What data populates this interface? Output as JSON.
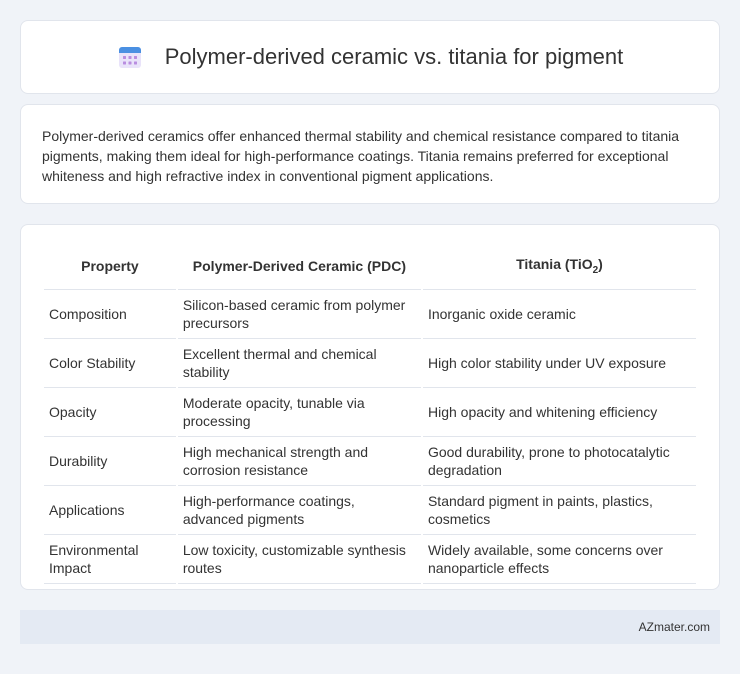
{
  "header": {
    "title": "Polymer-derived ceramic vs. titania for pigment",
    "icon": "calendar-icon"
  },
  "intro": {
    "text": "Polymer-derived ceramics offer enhanced thermal stability and chemical resistance compared to titania pigments, making them ideal for high-performance coatings. Titania remains preferred for exceptional whiteness and high refractive index in conventional pigment applications."
  },
  "table": {
    "headers": {
      "property": "Property",
      "pdc": "Polymer-Derived Ceramic (PDC)",
      "titania_prefix": "Titania (TiO",
      "titania_sub": "2",
      "titania_suffix": ")"
    },
    "rows": [
      {
        "property": "Composition",
        "pdc": "Silicon-based ceramic from polymer precursors",
        "titania": "Inorganic oxide ceramic"
      },
      {
        "property": "Color Stability",
        "pdc": "Excellent thermal and chemical stability",
        "titania": "High color stability under UV exposure"
      },
      {
        "property": "Opacity",
        "pdc": "Moderate opacity, tunable via processing",
        "titania": "High opacity and whitening efficiency"
      },
      {
        "property": "Durability",
        "pdc": "High mechanical strength and corrosion resistance",
        "titania": "Good durability, prone to photocatalytic degradation"
      },
      {
        "property": "Applications",
        "pdc": "High-performance coatings, advanced pigments",
        "titania": "Standard pigment in paints, plastics, cosmetics"
      },
      {
        "property": "Environmental Impact",
        "pdc": "Low toxicity, customizable synthesis routes",
        "titania": "Widely available, some concerns over nanoparticle effects"
      }
    ]
  },
  "footer": {
    "site": "AZmater.com"
  },
  "colors": {
    "background": "#f0f3f8",
    "card": "#ffffff",
    "footer_bg": "#e4eaf3",
    "icon_blue": "#4a90e2",
    "icon_purple": "#b98de0"
  }
}
